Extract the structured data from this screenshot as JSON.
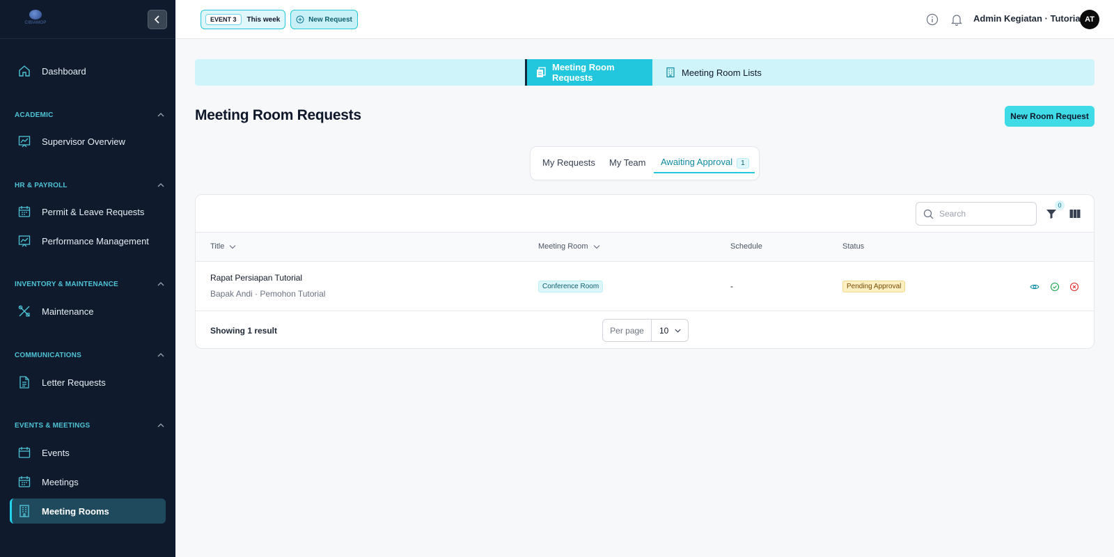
{
  "app": {
    "logo_text": "CIBIAMOP"
  },
  "sidebar": {
    "dashboard": "Dashboard",
    "sections": [
      {
        "title": "ACADEMIC",
        "items": [
          "Supervisor Overview"
        ]
      },
      {
        "title": "HR & PAYROLL",
        "items": [
          "Permit & Leave Requests",
          "Performance Management"
        ]
      },
      {
        "title": "INVENTORY & MAINTENANCE",
        "items": [
          "Maintenance"
        ]
      },
      {
        "title": "COMMUNICATIONS",
        "items": [
          "Letter Requests"
        ]
      },
      {
        "title": "EVENTS & MEETINGS",
        "items": [
          "Events",
          "Meetings",
          "Meeting Rooms"
        ]
      }
    ],
    "active_item": "Meeting Rooms"
  },
  "topbar": {
    "event_tag": "EVENT 3",
    "event_period": "This week",
    "new_request": "New Request",
    "user_name": "Admin Kegiatan · Tutorial",
    "avatar_initials": "AT"
  },
  "module_tabs": {
    "requests": "Meeting Room Requests",
    "lists": "Meeting Room Lists"
  },
  "page": {
    "title": "Meeting Room Requests",
    "primary_action": "New Room Request"
  },
  "filter_tabs": {
    "my_requests": "My Requests",
    "my_team": "My Team",
    "awaiting": "Awaiting Approval",
    "awaiting_count": "1"
  },
  "table": {
    "search_placeholder": "Search",
    "filter_count": "0",
    "columns": {
      "title": "Title",
      "room": "Meeting Room",
      "schedule": "Schedule",
      "status": "Status"
    },
    "rows": [
      {
        "title": "Rapat Persiapan Tutorial",
        "subtitle": "Bapak Andi · Pemohon Tutorial",
        "room": "Conference Room",
        "schedule": "-",
        "status": "Pending Approval"
      }
    ],
    "footer": {
      "showing": "Showing 1 result",
      "per_page_label": "Per page",
      "per_page_value": "10"
    }
  },
  "colors": {
    "accent": "#22c7dd",
    "sidebar_bg": "#0f1b2d",
    "status_pending": "#fdefc4"
  },
  "icons": [
    "chevron-left-icon",
    "home-icon",
    "chart-icon",
    "calendar-icon",
    "tools-icon",
    "document-icon",
    "building-icon",
    "info-icon",
    "bell-icon",
    "search-icon",
    "filter-icon",
    "columns-icon",
    "eye-icon",
    "check-circle-icon",
    "x-circle-icon",
    "chevron-up-icon",
    "chevron-down-icon"
  ]
}
